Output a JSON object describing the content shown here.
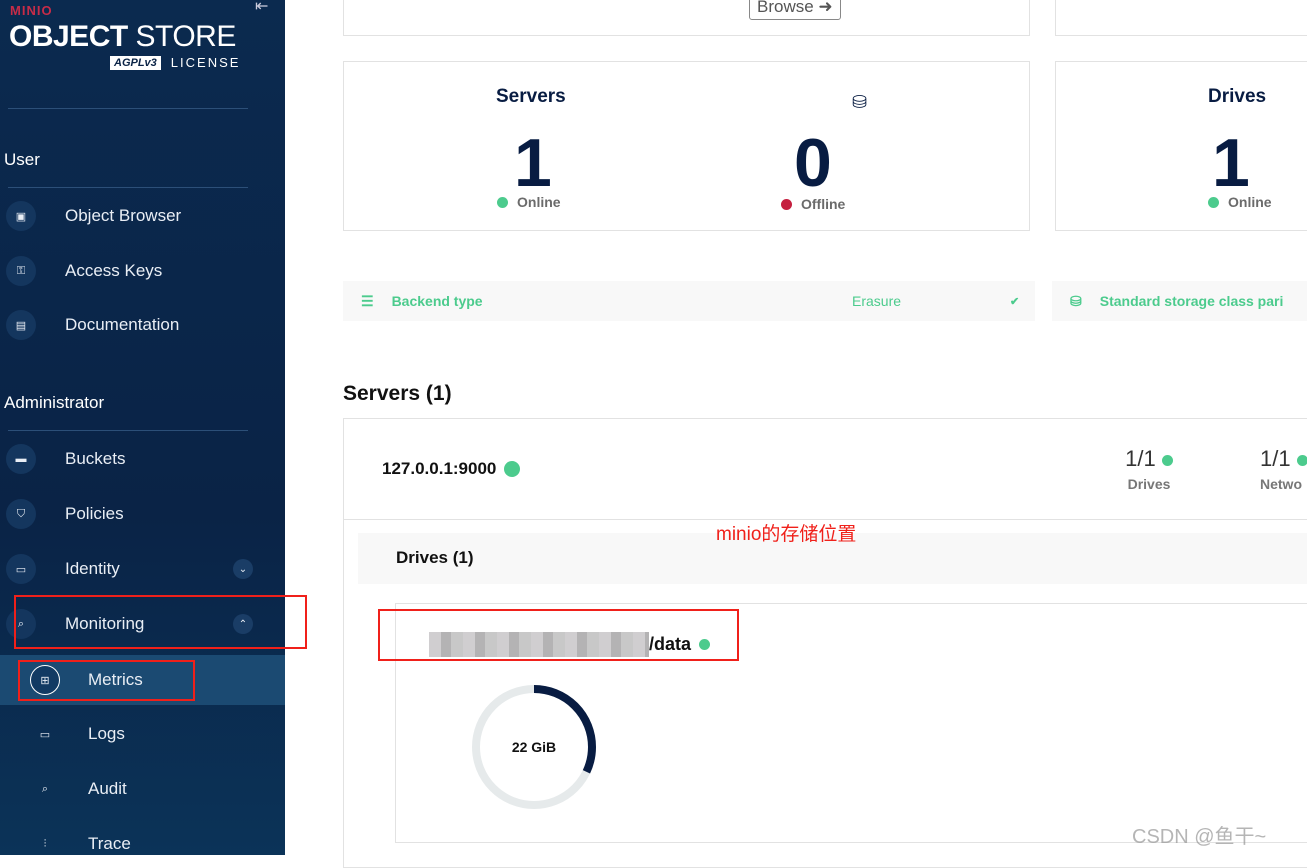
{
  "sidebar": {
    "brand": "MINIO",
    "product_bold": "OBJECT",
    "product_light": "STORE",
    "license_badge": "AGPLv3",
    "license": "LICENSE",
    "user_section": "User",
    "admin_section": "Administrator",
    "user_items": [
      {
        "label": "Object Browser",
        "icon": "object-browser-icon"
      },
      {
        "label": "Access Keys",
        "icon": "key-icon"
      },
      {
        "label": "Documentation",
        "icon": "document-icon"
      }
    ],
    "admin_items": [
      {
        "label": "Buckets",
        "icon": "bucket-icon"
      },
      {
        "label": "Policies",
        "icon": "shield-icon"
      },
      {
        "label": "Identity",
        "icon": "id-card-icon"
      },
      {
        "label": "Monitoring",
        "icon": "monitoring-icon"
      }
    ],
    "monitoring_items": [
      {
        "label": "Metrics",
        "icon": "grid-icon",
        "active": true
      },
      {
        "label": "Logs",
        "icon": "logs-icon"
      },
      {
        "label": "Audit",
        "icon": "audit-icon"
      },
      {
        "label": "Trace",
        "icon": "trace-icon"
      }
    ]
  },
  "top": {
    "browse_label": "Browse"
  },
  "servers_card": {
    "title": "Servers",
    "online_value": "1",
    "online_label": "Online",
    "offline_value": "0",
    "offline_label": "Offline"
  },
  "drives_card": {
    "title": "Drives",
    "online_value": "1",
    "online_label": "Online"
  },
  "backend": {
    "label": "Backend type",
    "value": "Erasure",
    "parity_label": "Standard storage class pari"
  },
  "servers_section": {
    "title": "Servers (1)",
    "server": "127.0.0.1:9000",
    "drives_value": "1/1",
    "drives_label": "Drives",
    "network_value": "1/1",
    "network_label": "Netwo"
  },
  "drives_section": {
    "title": "Drives (1)",
    "drive_path": "/data",
    "capacity": "22 GiB",
    "used_fraction": 0.32
  },
  "annotation": "minio的存储位置",
  "watermark": "CSDN @鱼干~",
  "colors": {
    "online": "#4ccb8d",
    "offline": "#c51f3f",
    "accent": "#081c42",
    "annotation": "#f0201a"
  }
}
